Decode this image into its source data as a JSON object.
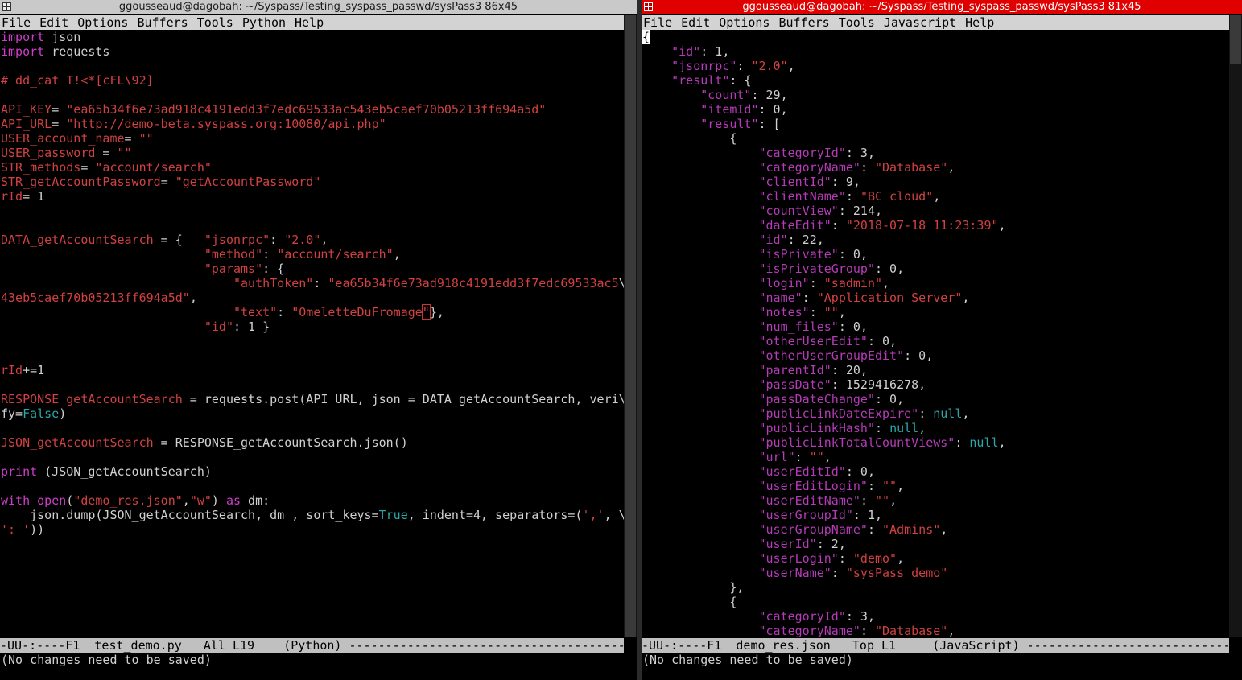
{
  "colors": {
    "keyword": "#cc3ec9",
    "string": "#d14141",
    "json_key": "#b63bb8",
    "null_bool": "#2aa8a8",
    "right_title_bg": "#e00000",
    "menubar_bg": "#d3d3d3",
    "modeline_bg": "#c0c0c0"
  },
  "left": {
    "title": "ggousseaud@dagobah: ~/Syspass/Testing_syspass_passwd/sysPass3 86x45",
    "menu": [
      "File",
      "Edit",
      "Options",
      "Buffers",
      "Tools",
      "Python",
      "Help"
    ],
    "code": [
      [
        [
          "kw",
          "import"
        ],
        [
          "p",
          " json"
        ]
      ],
      [
        [
          "kw",
          "import"
        ],
        [
          "p",
          " requests"
        ]
      ],
      [],
      [
        [
          "cmt",
          "# dd_cat T!<*[cFL\\92]"
        ]
      ],
      [],
      [
        [
          "var",
          "API_KEY"
        ],
        [
          "p",
          "= "
        ],
        [
          "str",
          "\"ea65b34f6e73ad918c4191edd3f7edc69533ac543eb5caef70b05213ff694a5d\""
        ]
      ],
      [
        [
          "var",
          "API_URL"
        ],
        [
          "p",
          "= "
        ],
        [
          "str",
          "\"http://demo-beta.syspass.org:10080/api.php\""
        ]
      ],
      [
        [
          "var",
          "USER_account_name"
        ],
        [
          "p",
          "= "
        ],
        [
          "str",
          "\"\""
        ]
      ],
      [
        [
          "var",
          "USER_password"
        ],
        [
          "p",
          " = "
        ],
        [
          "str",
          "\"\""
        ]
      ],
      [
        [
          "var",
          "STR_methods"
        ],
        [
          "p",
          "= "
        ],
        [
          "str",
          "\"account/search\""
        ]
      ],
      [
        [
          "var",
          "STR_getAccountPassword"
        ],
        [
          "p",
          "= "
        ],
        [
          "str",
          "\"getAccountPassword\""
        ]
      ],
      [
        [
          "var",
          "rId"
        ],
        [
          "p",
          "= 1"
        ]
      ],
      [],
      [],
      [
        [
          "var",
          "DATA_getAccountSearch"
        ],
        [
          "p",
          " = {   "
        ],
        [
          "str",
          "\"jsonrpc\""
        ],
        [
          "p",
          ": "
        ],
        [
          "str",
          "\"2.0\""
        ],
        [
          "p",
          ","
        ]
      ],
      [
        [
          "p",
          "                            "
        ],
        [
          "str",
          "\"method\""
        ],
        [
          "p",
          ": "
        ],
        [
          "str",
          "\"account/search\""
        ],
        [
          "p",
          ","
        ]
      ],
      [
        [
          "p",
          "                            "
        ],
        [
          "str",
          "\"params\""
        ],
        [
          "p",
          ": {"
        ]
      ],
      [
        [
          "p",
          "                                "
        ],
        [
          "str",
          "\"authToken\""
        ],
        [
          "p",
          ": "
        ],
        [
          "str",
          "\"ea65b34f6e73ad918c4191edd3f7edc69533ac5"
        ],
        [
          "p",
          "\\"
        ]
      ],
      [
        [
          "str",
          "43eb5caef70b05213ff694a5d\""
        ],
        [
          "p",
          ","
        ]
      ],
      [
        [
          "p",
          "                                "
        ],
        [
          "str",
          "\"text\""
        ],
        [
          "p",
          ": "
        ],
        [
          "str",
          "\"OmeletteDuFromage"
        ],
        [
          "cur",
          "\""
        ],
        [
          "p",
          "},"
        ]
      ],
      [
        [
          "p",
          "                            "
        ],
        [
          "str",
          "\"id\""
        ],
        [
          "p",
          ": 1 }"
        ]
      ],
      [],
      [],
      [
        [
          "var",
          "rId"
        ],
        [
          "p",
          "+=1"
        ]
      ],
      [],
      [
        [
          "var",
          "RESPONSE_getAccountSearch"
        ],
        [
          "p",
          " = requests.post(API_URL, json = DATA_getAccountSearch, veri\\"
        ]
      ],
      [
        [
          "p",
          "fy="
        ],
        [
          "bool",
          "False"
        ],
        [
          "p",
          ")"
        ]
      ],
      [],
      [
        [
          "var",
          "JSON_getAccountSearch"
        ],
        [
          "p",
          " = RESPONSE_getAccountSearch.json()"
        ]
      ],
      [],
      [
        [
          "kw",
          "print"
        ],
        [
          "p",
          " (JSON_getAccountSearch)"
        ]
      ],
      [],
      [
        [
          "kw",
          "with"
        ],
        [
          "p",
          " "
        ],
        [
          "kw",
          "open"
        ],
        [
          "p",
          "("
        ],
        [
          "str",
          "\"demo_res.json\""
        ],
        [
          "p",
          ","
        ],
        [
          "str",
          "\"w\""
        ],
        [
          "p",
          ") "
        ],
        [
          "kw",
          "as"
        ],
        [
          "p",
          " dm:"
        ]
      ],
      [
        [
          "p",
          "    json.dump(JSON_getAccountSearch, dm , sort_keys="
        ],
        [
          "bool",
          "True"
        ],
        [
          "p",
          ", indent=4, separators=("
        ],
        [
          "str",
          "','"
        ],
        [
          "p",
          ", \\"
        ]
      ],
      [
        [
          "str",
          "': '"
        ],
        [
          "p",
          "))"
        ]
      ]
    ],
    "modeline": "-UU-:----F1  test_demo.py   All L19    (Python) -------------------------------------------",
    "echo": "(No changes need to be saved)"
  },
  "right": {
    "title": "ggousseaud@dagobah: ~/Syspass/Testing_syspass_passwd/sysPass3 81x45",
    "menu": [
      "File",
      "Edit",
      "Options",
      "Buffers",
      "Tools",
      "Javascript",
      "Help"
    ],
    "code": [
      [
        [
          "blk",
          "{"
        ]
      ],
      [
        [
          "p",
          "    "
        ],
        [
          "key",
          "\"id\""
        ],
        [
          "p",
          ": 1,"
        ]
      ],
      [
        [
          "p",
          "    "
        ],
        [
          "key",
          "\"jsonrpc\""
        ],
        [
          "p",
          ": "
        ],
        [
          "str",
          "\"2.0\""
        ],
        [
          "p",
          ","
        ]
      ],
      [
        [
          "p",
          "    "
        ],
        [
          "key",
          "\"result\""
        ],
        [
          "p",
          ": {"
        ]
      ],
      [
        [
          "p",
          "        "
        ],
        [
          "key",
          "\"count\""
        ],
        [
          "p",
          ": 29,"
        ]
      ],
      [
        [
          "p",
          "        "
        ],
        [
          "key",
          "\"itemId\""
        ],
        [
          "p",
          ": 0,"
        ]
      ],
      [
        [
          "p",
          "        "
        ],
        [
          "key",
          "\"result\""
        ],
        [
          "p",
          ": ["
        ]
      ],
      [
        [
          "p",
          "            {"
        ]
      ],
      [
        [
          "p",
          "                "
        ],
        [
          "key",
          "\"categoryId\""
        ],
        [
          "p",
          ": 3,"
        ]
      ],
      [
        [
          "p",
          "                "
        ],
        [
          "key",
          "\"categoryName\""
        ],
        [
          "p",
          ": "
        ],
        [
          "str",
          "\"Database\""
        ],
        [
          "p",
          ","
        ]
      ],
      [
        [
          "p",
          "                "
        ],
        [
          "key",
          "\"clientId\""
        ],
        [
          "p",
          ": 9,"
        ]
      ],
      [
        [
          "p",
          "                "
        ],
        [
          "key",
          "\"clientName\""
        ],
        [
          "p",
          ": "
        ],
        [
          "str",
          "\"BC cloud\""
        ],
        [
          "p",
          ","
        ]
      ],
      [
        [
          "p",
          "                "
        ],
        [
          "key",
          "\"countView\""
        ],
        [
          "p",
          ": 214,"
        ]
      ],
      [
        [
          "p",
          "                "
        ],
        [
          "key",
          "\"dateEdit\""
        ],
        [
          "p",
          ": "
        ],
        [
          "str",
          "\"2018-07-18 11:23:39\""
        ],
        [
          "p",
          ","
        ]
      ],
      [
        [
          "p",
          "                "
        ],
        [
          "key",
          "\"id\""
        ],
        [
          "p",
          ": 22,"
        ]
      ],
      [
        [
          "p",
          "                "
        ],
        [
          "key",
          "\"isPrivate\""
        ],
        [
          "p",
          ": 0,"
        ]
      ],
      [
        [
          "p",
          "                "
        ],
        [
          "key",
          "\"isPrivateGroup\""
        ],
        [
          "p",
          ": 0,"
        ]
      ],
      [
        [
          "p",
          "                "
        ],
        [
          "key",
          "\"login\""
        ],
        [
          "p",
          ": "
        ],
        [
          "str",
          "\"sadmin\""
        ],
        [
          "p",
          ","
        ]
      ],
      [
        [
          "p",
          "                "
        ],
        [
          "key",
          "\"name\""
        ],
        [
          "p",
          ": "
        ],
        [
          "str",
          "\"Application Server\""
        ],
        [
          "p",
          ","
        ]
      ],
      [
        [
          "p",
          "                "
        ],
        [
          "key",
          "\"notes\""
        ],
        [
          "p",
          ": "
        ],
        [
          "str",
          "\"\""
        ],
        [
          "p",
          ","
        ]
      ],
      [
        [
          "p",
          "                "
        ],
        [
          "key",
          "\"num_files\""
        ],
        [
          "p",
          ": 0,"
        ]
      ],
      [
        [
          "p",
          "                "
        ],
        [
          "key",
          "\"otherUserEdit\""
        ],
        [
          "p",
          ": 0,"
        ]
      ],
      [
        [
          "p",
          "                "
        ],
        [
          "key",
          "\"otherUserGroupEdit\""
        ],
        [
          "p",
          ": 0,"
        ]
      ],
      [
        [
          "p",
          "                "
        ],
        [
          "key",
          "\"parentId\""
        ],
        [
          "p",
          ": 20,"
        ]
      ],
      [
        [
          "p",
          "                "
        ],
        [
          "key",
          "\"passDate\""
        ],
        [
          "p",
          ": 1529416278,"
        ]
      ],
      [
        [
          "p",
          "                "
        ],
        [
          "key",
          "\"passDateChange\""
        ],
        [
          "p",
          ": 0,"
        ]
      ],
      [
        [
          "p",
          "                "
        ],
        [
          "key",
          "\"publicLinkDateExpire\""
        ],
        [
          "p",
          ": "
        ],
        [
          "null",
          "null"
        ],
        [
          "p",
          ","
        ]
      ],
      [
        [
          "p",
          "                "
        ],
        [
          "key",
          "\"publicLinkHash\""
        ],
        [
          "p",
          ": "
        ],
        [
          "null",
          "null"
        ],
        [
          "p",
          ","
        ]
      ],
      [
        [
          "p",
          "                "
        ],
        [
          "key",
          "\"publicLinkTotalCountViews\""
        ],
        [
          "p",
          ": "
        ],
        [
          "null",
          "null"
        ],
        [
          "p",
          ","
        ]
      ],
      [
        [
          "p",
          "                "
        ],
        [
          "key",
          "\"url\""
        ],
        [
          "p",
          ": "
        ],
        [
          "str",
          "\"\""
        ],
        [
          "p",
          ","
        ]
      ],
      [
        [
          "p",
          "                "
        ],
        [
          "key",
          "\"userEditId\""
        ],
        [
          "p",
          ": 0,"
        ]
      ],
      [
        [
          "p",
          "                "
        ],
        [
          "key",
          "\"userEditLogin\""
        ],
        [
          "p",
          ": "
        ],
        [
          "str",
          "\"\""
        ],
        [
          "p",
          ","
        ]
      ],
      [
        [
          "p",
          "                "
        ],
        [
          "key",
          "\"userEditName\""
        ],
        [
          "p",
          ": "
        ],
        [
          "str",
          "\"\""
        ],
        [
          "p",
          ","
        ]
      ],
      [
        [
          "p",
          "                "
        ],
        [
          "key",
          "\"userGroupId\""
        ],
        [
          "p",
          ": 1,"
        ]
      ],
      [
        [
          "p",
          "                "
        ],
        [
          "key",
          "\"userGroupName\""
        ],
        [
          "p",
          ": "
        ],
        [
          "str",
          "\"Admins\""
        ],
        [
          "p",
          ","
        ]
      ],
      [
        [
          "p",
          "                "
        ],
        [
          "key",
          "\"userId\""
        ],
        [
          "p",
          ": 2,"
        ]
      ],
      [
        [
          "p",
          "                "
        ],
        [
          "key",
          "\"userLogin\""
        ],
        [
          "p",
          ": "
        ],
        [
          "str",
          "\"demo\""
        ],
        [
          "p",
          ","
        ]
      ],
      [
        [
          "p",
          "                "
        ],
        [
          "key",
          "\"userName\""
        ],
        [
          "p",
          ": "
        ],
        [
          "str",
          "\"sysPass demo\""
        ]
      ],
      [
        [
          "p",
          "            },"
        ]
      ],
      [
        [
          "p",
          "            {"
        ]
      ],
      [
        [
          "p",
          "                "
        ],
        [
          "key",
          "\"categoryId\""
        ],
        [
          "p",
          ": 3,"
        ]
      ],
      [
        [
          "p",
          "                "
        ],
        [
          "key",
          "\"categoryName\""
        ],
        [
          "p",
          ": "
        ],
        [
          "str",
          "\"Database\""
        ],
        [
          "p",
          ","
        ]
      ]
    ],
    "modeline": "-UU-:----F1  demo_res.json   Top L1     (JavaScript) -----------------------------",
    "echo": "(No changes need to be saved)"
  }
}
